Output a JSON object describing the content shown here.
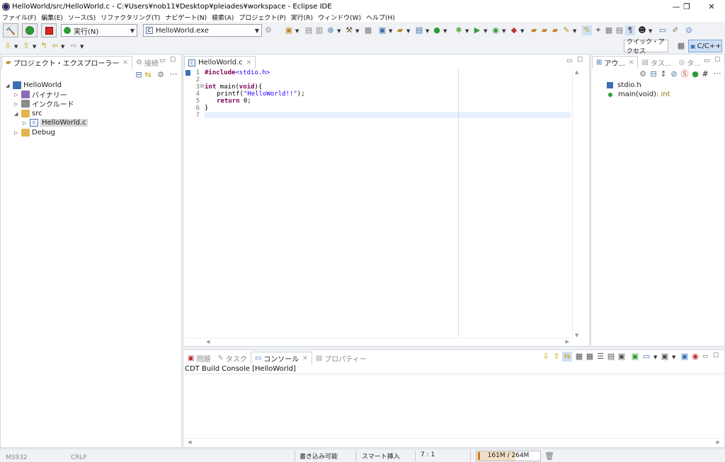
{
  "window": {
    "title": "HelloWorld/src/HelloWorld.c - C:¥Users¥nob11¥Desktop¥pleiades¥workspace - Eclipse IDE",
    "minimize": "—",
    "restore": "❐",
    "close": "✕"
  },
  "menu": [
    "ファイル(F)",
    "編集(E)",
    "ソース(S)",
    "リファクタリング(T)",
    "ナビゲート(N)",
    "検索(A)",
    "プロジェクト(P)",
    "実行(R)",
    "ウィンドウ(W)",
    "ヘルプ(H)"
  ],
  "toolbar": {
    "launch_mode": "実行(N)",
    "launch_config": "HelloWorld.exe",
    "quick_access": "クイック・アクセス",
    "perspective": "C/C++"
  },
  "explorer": {
    "tabs": [
      {
        "label": "プロジェクト・エクスプローラー"
      },
      {
        "label": "接続"
      }
    ],
    "tree": [
      {
        "label": "HelloWorld",
        "expanded": true
      },
      {
        "label": "バイナリー",
        "expanded": false
      },
      {
        "label": "インクルード",
        "expanded": false
      },
      {
        "label": "src",
        "expanded": true
      },
      {
        "label": "HelloWorld.c",
        "expanded": false,
        "selected": true
      },
      {
        "label": "Debug",
        "expanded": false
      }
    ]
  },
  "editor": {
    "tab": "HelloWorld.c",
    "line_numbers": [
      "1",
      "2",
      "3",
      "4",
      "5",
      "6",
      "7"
    ],
    "code": {
      "l1_directive": "#include",
      "l1_header": "<stdio.h>",
      "l3_kw1": "int",
      "l3_rest": " main(",
      "l3_kw2": "void",
      "l3_end": "){",
      "l4_fn": "printf(",
      "l4_str": "\"HelloWorld!!\"",
      "l4_end": ");",
      "l5_kw": "return",
      "l5_rest": " 0;",
      "l6": "}"
    },
    "cursor_line": 7
  },
  "outline": {
    "tabs": [
      {
        "label": "アウ..."
      },
      {
        "label": "タス..."
      },
      {
        "label": "タ..."
      }
    ],
    "items": [
      {
        "label": "stdio.h",
        "type": ""
      },
      {
        "label": "main(void)",
        "type": " : int"
      }
    ]
  },
  "bottom": {
    "tabs": [
      {
        "label": "問題"
      },
      {
        "label": "タスク"
      },
      {
        "label": "コンソール"
      },
      {
        "label": "プロパティー"
      }
    ],
    "console_title": "CDT Build Console [HelloWorld]"
  },
  "status": {
    "writable": "書き込み可能",
    "insert_mode": "スマート挿入",
    "position": "7 : 1",
    "memory": "161M / 264M",
    "memory_fraction": 0.61,
    "left1": "MS932",
    "left2": "CRLF"
  },
  "colors": {
    "accent": "#3d6fb5",
    "keyword": "#7f0055",
    "string": "#2a00ff",
    "current_line": "#e8f2fe"
  }
}
